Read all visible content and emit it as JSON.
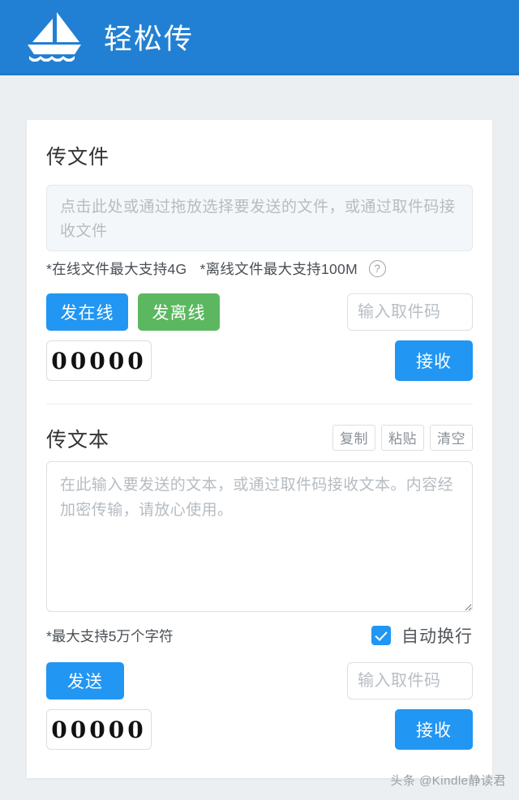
{
  "header": {
    "title": "轻松传",
    "logo_icon": "sailboat-icon",
    "background_color": "#2180d3"
  },
  "file_section": {
    "title": "传文件",
    "dropzone_placeholder": "点击此处或通过拖放选择要发送的文件，或通过取件码接收文件",
    "hint_online": "*在线文件最大支持4G",
    "hint_offline": "*离线文件最大支持100M",
    "help_icon": "question-circle-icon",
    "send_online_label": "发在线",
    "send_offline_label": "发离线",
    "code_value": "00000",
    "code_input_placeholder": "输入取件码",
    "code_input_value": "",
    "receive_label": "接收"
  },
  "text_section": {
    "title": "传文本",
    "copy_label": "复制",
    "paste_label": "粘贴",
    "clear_label": "清空",
    "textarea_placeholder": "在此输入要发送的文本，或通过取件码接收文本。内容经加密传输，请放心使用。",
    "textarea_value": "",
    "hint_max_chars": "*最大支持5万个字符",
    "wrap_label": "自动换行",
    "wrap_checked": true,
    "send_label": "发送",
    "code_value": "00000",
    "code_input_placeholder": "输入取件码",
    "code_input_value": "",
    "receive_label": "接收"
  },
  "watermark": {
    "text": "头条 @Kindle静读君"
  },
  "colors": {
    "brand_blue": "#2180d3",
    "button_blue": "#2196f3",
    "button_green": "#5cb860",
    "page_background": "#eceff1"
  }
}
